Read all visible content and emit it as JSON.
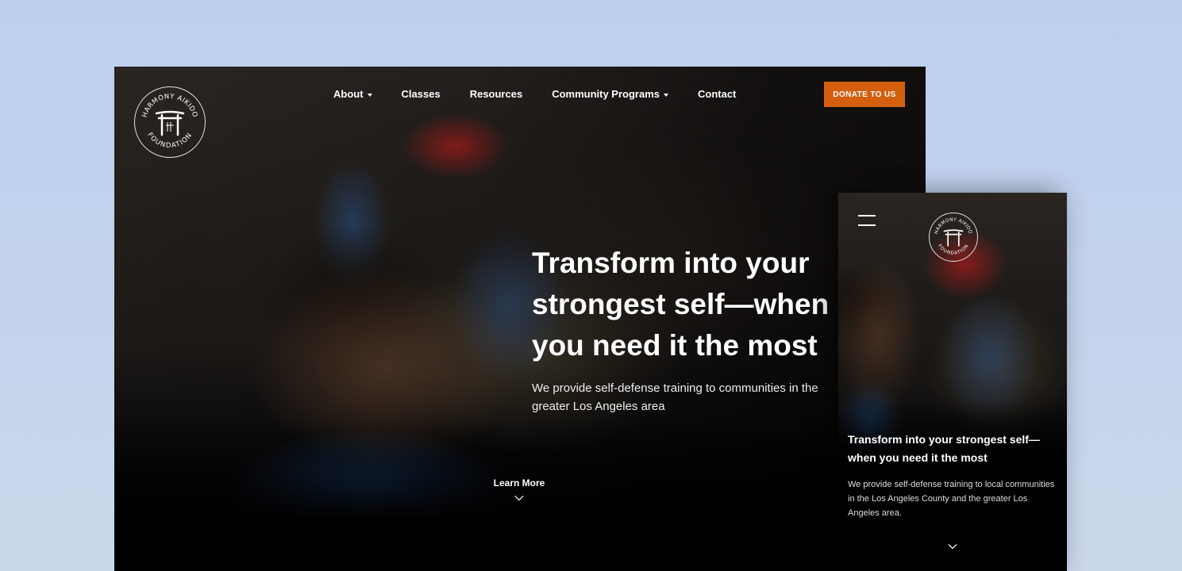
{
  "logo": {
    "top_text": "HARMONY AIKIDO",
    "bottom_text": "FOUNDATION"
  },
  "nav": {
    "items": [
      {
        "label": "About",
        "has_dropdown": true
      },
      {
        "label": "Classes",
        "has_dropdown": false
      },
      {
        "label": "Resources",
        "has_dropdown": false
      },
      {
        "label": "Community Programs",
        "has_dropdown": true
      },
      {
        "label": "Contact",
        "has_dropdown": false
      }
    ],
    "donate_label": "DONATE TO US"
  },
  "hero": {
    "title": "Transform into your strongest self—when you need it the most",
    "subtitle": "We provide self-defense training to communities in the greater Los Angeles area",
    "learn_more": "Learn More"
  },
  "mobile": {
    "title": "Transform into your strongest self—when you need it the most",
    "subtitle": "We provide self-defense training to local communities in the Los Angeles County and the greater Los Angeles area."
  },
  "colors": {
    "accent": "#d35f0f",
    "background_top": "#bccfee",
    "background_bottom": "#cbd8ea"
  },
  "icons": [
    "torii-gate-icon",
    "chevron-down-icon",
    "hamburger-menu-icon",
    "caret-down-icon"
  ]
}
